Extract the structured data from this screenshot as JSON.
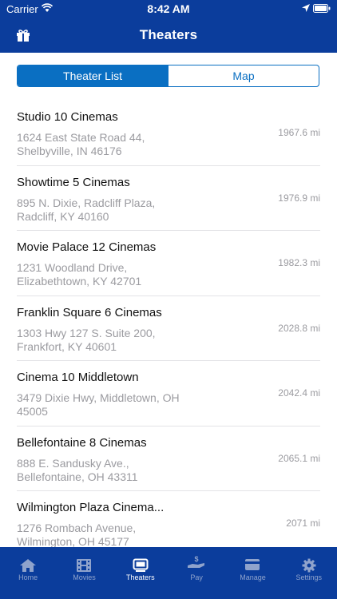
{
  "status": {
    "carrier": "Carrier",
    "time": "8:42 AM"
  },
  "header": {
    "title": "Theaters"
  },
  "segments": {
    "list_label": "Theater List",
    "map_label": "Map"
  },
  "theaters": [
    {
      "name": "Studio 10 Cinemas",
      "address": "1624 East State Road 44, Shelbyville, IN 46176",
      "distance": "1967.6 mi"
    },
    {
      "name": "Showtime 5 Cinemas",
      "address": "895 N. Dixie, Radcliff Plaza, Radcliff, KY 40160",
      "distance": "1976.9 mi"
    },
    {
      "name": "Movie Palace 12 Cinemas",
      "address": "1231 Woodland Drive, Elizabethtown, KY 42701",
      "distance": "1982.3 mi"
    },
    {
      "name": "Franklin Square 6 Cinemas",
      "address": "1303 Hwy 127 S. Suite 200, Frankfort, KY 40601",
      "distance": "2028.8 mi"
    },
    {
      "name": "Cinema 10 Middletown",
      "address": "3479 Dixie Hwy, Middletown, OH 45005",
      "distance": "2042.4 mi"
    },
    {
      "name": "Bellefontaine 8 Cinemas",
      "address": "888 E. Sandusky Ave., Bellefontaine, OH 43311",
      "distance": "2065.1 mi"
    },
    {
      "name": "Wilmington Plaza Cinema...",
      "address": "1276 Rombach Avenue, Wilmington, OH 45177",
      "distance": "2071 mi"
    }
  ],
  "tabs": {
    "home": "Home",
    "movies": "Movies",
    "theaters": "Theaters",
    "pay": "Pay",
    "manage": "Manage",
    "settings": "Settings"
  },
  "colors": {
    "brand": "#0b3d9c",
    "accent": "#0a6fc2",
    "muted_text": "#9b9ba0"
  }
}
